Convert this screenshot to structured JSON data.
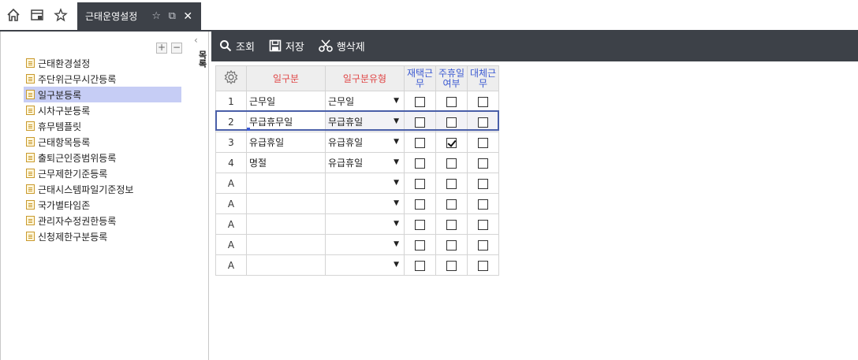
{
  "top_icons": {
    "home": "home-icon",
    "window": "window-list-icon",
    "favorite": "star-icon"
  },
  "tab": {
    "label": "근태운영설정"
  },
  "tree_controls": {
    "expand": "+",
    "collapse": "−"
  },
  "rail": {
    "label": "목록"
  },
  "tree": {
    "items": [
      {
        "label": "근태환경설정"
      },
      {
        "label": "주단위근무시간등록"
      },
      {
        "label": "일구분등록",
        "selected": true
      },
      {
        "label": "시차구분등록"
      },
      {
        "label": "휴무템플릿"
      },
      {
        "label": "근태항목등록"
      },
      {
        "label": "출퇴근인증범위등록"
      },
      {
        "label": "근무제한기준등록"
      },
      {
        "label": "근태시스템파일기준정보"
      },
      {
        "label": "국가별타임존"
      },
      {
        "label": "관리자수정권한등록"
      },
      {
        "label": "신청제한구분등록"
      }
    ]
  },
  "toolbar": {
    "search_label": "조회",
    "save_label": "저장",
    "delete_row_label": "행삭제"
  },
  "grid": {
    "headers": {
      "day_type": "일구분",
      "day_type_kind": "일구분유형",
      "remote_work_1": "재택근",
      "remote_work_2": "무",
      "weekly_holiday_1": "주휴일",
      "weekly_holiday_2": "여부",
      "substitute_1": "대체근",
      "substitute_2": "무"
    },
    "rows": [
      {
        "num": "1",
        "day_type": "근무일",
        "kind": "근무일",
        "remote": false,
        "weekly": false,
        "substitute": false
      },
      {
        "num": "2",
        "day_type": "무급휴무일",
        "kind": "무급휴일",
        "remote": false,
        "weekly": false,
        "substitute": false
      },
      {
        "num": "3",
        "day_type": "유급휴일",
        "kind": "유급휴일",
        "remote": false,
        "weekly": true,
        "substitute": false
      },
      {
        "num": "4",
        "day_type": "명절",
        "kind": "유급휴일",
        "remote": false,
        "weekly": false,
        "substitute": false
      },
      {
        "num": "A",
        "day_type": "",
        "kind": "",
        "remote": false,
        "weekly": false,
        "substitute": false
      },
      {
        "num": "A",
        "day_type": "",
        "kind": "",
        "remote": false,
        "weekly": false,
        "substitute": false
      },
      {
        "num": "A",
        "day_type": "",
        "kind": "",
        "remote": false,
        "weekly": false,
        "substitute": false
      },
      {
        "num": "A",
        "day_type": "",
        "kind": "",
        "remote": false,
        "weekly": false,
        "substitute": false
      },
      {
        "num": "A",
        "day_type": "",
        "kind": "",
        "remote": false,
        "weekly": false,
        "substitute": false
      }
    ]
  }
}
